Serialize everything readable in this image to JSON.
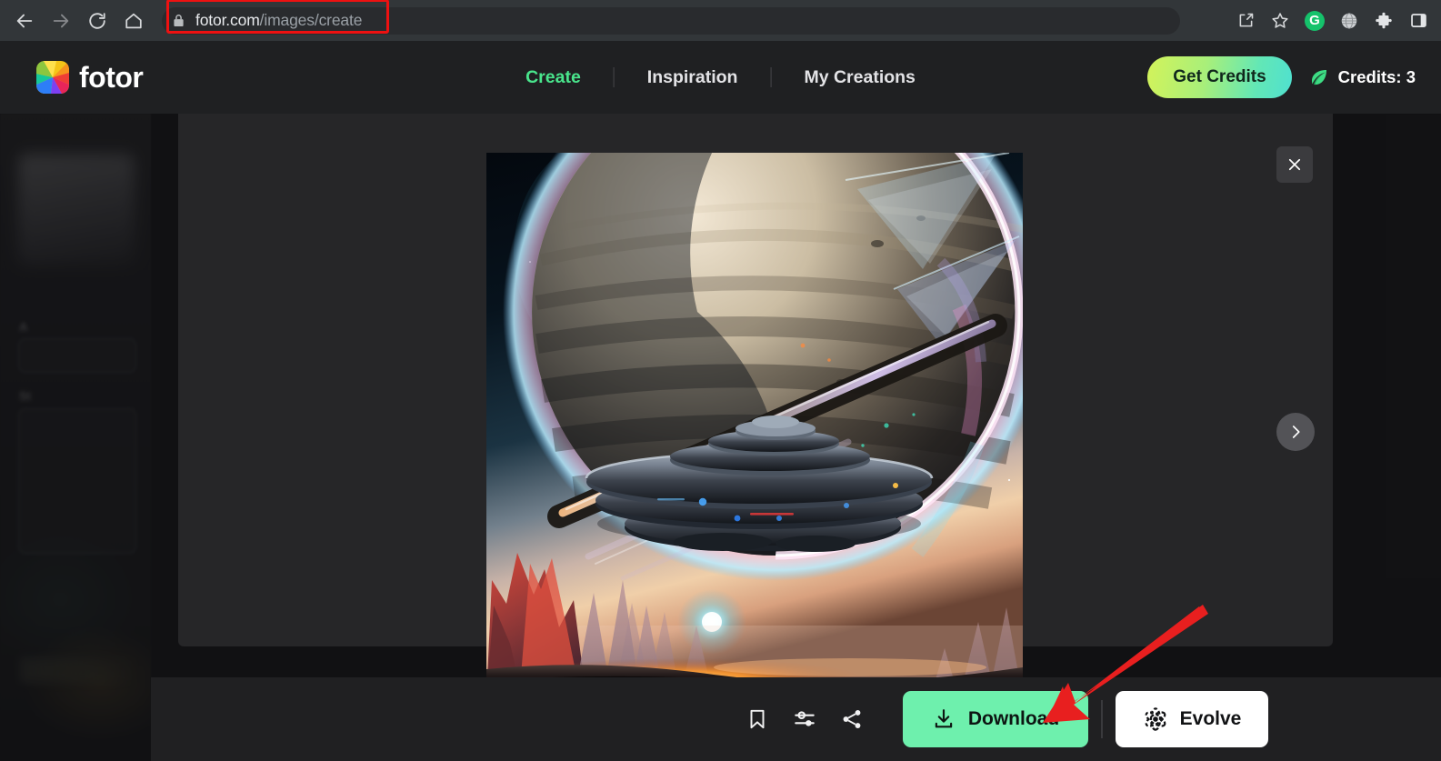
{
  "browser": {
    "back_icon": "back-arrow-icon",
    "forward_icon": "forward-arrow-icon",
    "reload_icon": "reload-icon",
    "home_icon": "home-icon",
    "lock_icon": "lock-icon",
    "url_host": "fotor.com",
    "url_path": "/images/create",
    "url_full": "fotor.com/images/create",
    "toolbar_icons": [
      {
        "name": "share-icon",
        "label": "Share this page"
      },
      {
        "name": "bookmark-star-icon",
        "label": "Bookmark this tab"
      },
      {
        "name": "grammarly-extension-icon",
        "label": "G",
        "color": "#15c26b"
      },
      {
        "name": "globe-extension-icon",
        "label": "Translate"
      },
      {
        "name": "extensions-puzzle-icon",
        "label": "Extensions"
      },
      {
        "name": "side-panel-icon",
        "label": "Side panel"
      }
    ],
    "annotation_color": "#ee1111"
  },
  "header": {
    "brand": "fotor",
    "nav": [
      {
        "label": "Create",
        "active": true
      },
      {
        "label": "Inspiration",
        "active": false
      },
      {
        "label": "My Creations",
        "active": false
      }
    ],
    "get_credits_label": "Get Credits",
    "credits_label": "Credits: 3",
    "credits_count": "3",
    "leaf_icon": "leaf-icon",
    "accent_green": "#49e58c",
    "credits_gradient_from": "#d3f35a",
    "credits_gradient_to": "#4fe0d0"
  },
  "sidebar": {
    "blurred": true,
    "labels": [
      "A",
      "St"
    ]
  },
  "modal": {
    "close_icon": "close-icon",
    "next_icon": "chevron-right-icon",
    "artwork_alt": "AI generated sci-fi scene: ringed gas giant planet above an alien desert landscape with red rock spires and a hovering flying saucer",
    "artwork_colors": {
      "space": "#07121c",
      "planet": "#ded2bd",
      "rim_glow": "#ffd9f2",
      "sunset": "#f7cfa8",
      "ground_glow": "#ff9a2e",
      "rock": "#c8453a"
    }
  },
  "actions": {
    "bookmark_icon": "bookmark-icon",
    "adjust_icon": "sliders-adjust-icon",
    "share_icon": "share-nodes-icon",
    "download_label": "Download",
    "download_icon": "download-icon",
    "download_color": "#6ef0ad",
    "evolve_label": "Evolve",
    "evolve_icon": "atom-icon",
    "evolve_color": "#ffffff"
  },
  "annotations": {
    "arrow_color": "#e81f1f",
    "arrow_target": "Download",
    "box_target": "fotor.com/images/create"
  }
}
